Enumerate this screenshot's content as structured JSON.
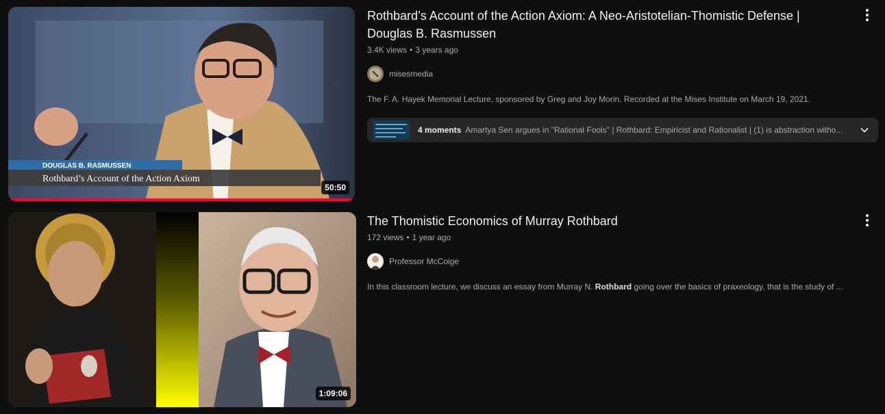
{
  "results": [
    {
      "title": "Rothbard’s Account of the Action Axiom: A Neo-Aristotelian-Thomistic Defense | Douglas B. Rasmussen",
      "views": "3.4K views",
      "age": "3 years ago",
      "channel": "misesmedia",
      "description": "The F. A. Hayek Memorial Lecture, sponsored by Greg and Joy Morin. Recorded at the Mises Institute on March 19, 2021.",
      "duration": "50:50",
      "watch_progress": 1.0,
      "overlay_name": "DOUGLAS B. RASMUSSEN",
      "overlay_title": "Rothbard’s Account of the Action Axiom",
      "moments_count": "4 moments",
      "moments_text": "Amartya Sen argues in \"Rational Fools\" | Rothbard: Empiricist and Rationalist | (1) is abstraction witho...",
      "icons": {
        "menu": "more-vert-icon",
        "expand": "chevron-down-icon"
      }
    },
    {
      "title": "The Thomistic Economics of Murray Rothbard",
      "views": "172 views",
      "age": "1 year ago",
      "channel": "Professor McCoige",
      "description_pre": "In this classroom lecture, we discuss an essay from Murray N. ",
      "description_bold": "Rothbard",
      "description_post": " going over the basics of praxeology, that is the study of ...",
      "duration": "1:09:06",
      "icons": {
        "menu": "more-vert-icon"
      }
    }
  ],
  "colors": {
    "background": "#0f0f0f",
    "progress": "#ff0033",
    "moments_bg": "#272727",
    "lower_third": "#2f6da8"
  },
  "separator": "•"
}
